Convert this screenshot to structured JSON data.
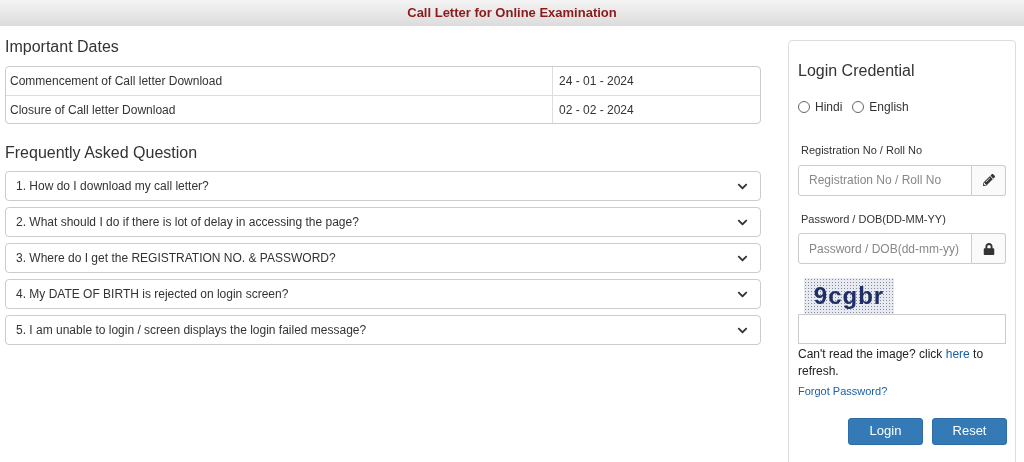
{
  "header": {
    "title": "Call Letter for Online Examination"
  },
  "important_dates": {
    "heading": "Important Dates",
    "rows": [
      {
        "label": "Commencement of Call letter Download",
        "date": "24 - 01 - 2024"
      },
      {
        "label": "Closure of Call letter Download",
        "date": "02 - 02 - 2024"
      }
    ]
  },
  "faq": {
    "heading": "Frequently Asked Question",
    "items": [
      {
        "question": "1. How do I download my call letter?",
        "expanded": false
      },
      {
        "question": "2. What should I do if there is lot of delay in accessing the page?",
        "expanded": false
      },
      {
        "question": "3. Where do I get the REGISTRATION NO. & PASSWORD?",
        "expanded": false
      },
      {
        "question": "4. My DATE OF BIRTH is rejected on login screen?",
        "expanded": false
      },
      {
        "question": "5. I am unable to login / screen displays the login failed message?",
        "expanded": false
      }
    ]
  },
  "login": {
    "title": "Login Credential",
    "languages": [
      {
        "label": "Hindi",
        "selected": false
      },
      {
        "label": "English",
        "selected": false
      }
    ],
    "fields": [
      {
        "kind": "text",
        "label": "Registration No / Roll No",
        "placeholder": "Registration No / Roll No"
      },
      {
        "kind": "password",
        "label": "Password / DOB(DD-MM-YY)",
        "placeholder": "Password / DOB(dd-mm-yy)"
      }
    ],
    "captcha": "9cgbr",
    "refresh_text": "Can't read the image? click ",
    "refresh_link": "here",
    "refresh_tail": " to refresh.",
    "forgot": "Forgot Password?",
    "buttons": [
      "Login",
      "Reset"
    ]
  }
}
